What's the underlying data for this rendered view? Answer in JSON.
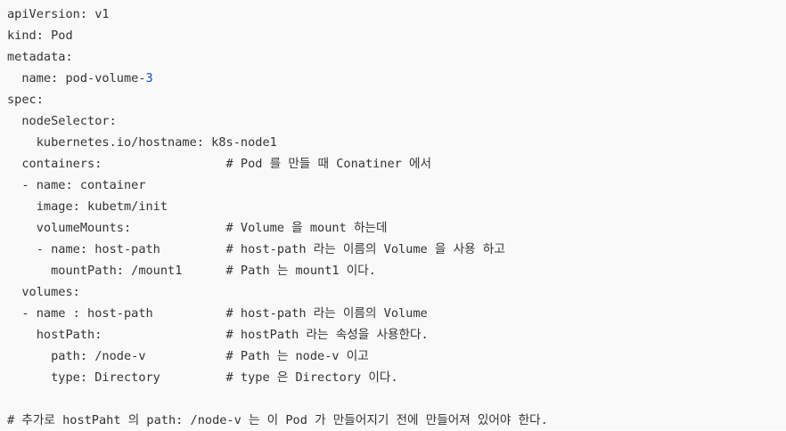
{
  "code_lines": [
    "apiVersion: v1",
    "kind: Pod",
    "metadata:",
    "  name: pod-volume-",
    "3",
    "spec:",
    "  nodeSelector:",
    "    kubernetes.io/hostname: k8s-node1",
    "  containers:                 # Pod 를 만들 때 Conatiner 에서",
    "  - name: container",
    "    image: kubetm/init",
    "    volumeMounts:             # Volume 을 mount 하는데",
    "    - name: host-path         # host-path 라는 이름의 Volume 을 사용 하고",
    "      mountPath: /mount1      # Path 는 mount1 이다.",
    "  volumes:",
    "  - name : host-path          # host-path 라는 이름의 Volume",
    "    hostPath:                 # hostPath 라는 속성을 사용한다.",
    "      path: /node-v           # Path 는 node-v 이고",
    "      type: Directory         # type 은 Directory 이다.",
    "",
    "# 추가로 hostPaht 의 path: /node-v 는 이 Pod 가 만들어지기 전에 만들어져 있어야 한다."
  ],
  "colors": {
    "background": "#f9f9f9",
    "text": "#333333",
    "number_highlight": "#0b4ad6"
  }
}
